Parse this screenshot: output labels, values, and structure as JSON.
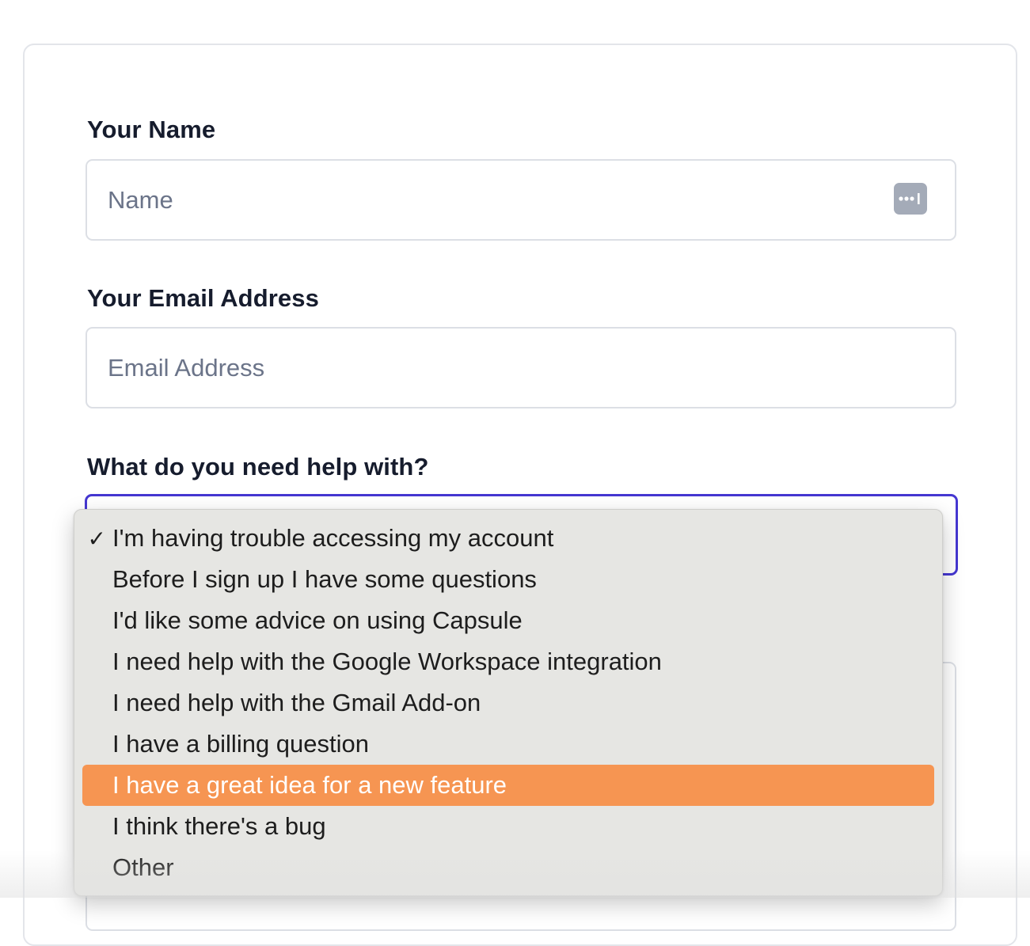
{
  "form": {
    "name_label": "Your Name",
    "name_placeholder": "Name",
    "email_label": "Your Email Address",
    "email_placeholder": "Email Address",
    "help_label": "What do you need help with?"
  },
  "dropdown": {
    "selected_check": "✓",
    "options": [
      {
        "label": "I'm having trouble accessing my account",
        "selected": true,
        "highlighted": false
      },
      {
        "label": "Before I sign up I have some questions",
        "selected": false,
        "highlighted": false
      },
      {
        "label": "I'd like some advice on using Capsule",
        "selected": false,
        "highlighted": false
      },
      {
        "label": "I need help with the Google Workspace integration",
        "selected": false,
        "highlighted": false
      },
      {
        "label": "I need help with the Gmail Add-on",
        "selected": false,
        "highlighted": false
      },
      {
        "label": "I have a billing question",
        "selected": false,
        "highlighted": false
      },
      {
        "label": "I have a great idea for a new feature",
        "selected": false,
        "highlighted": true
      },
      {
        "label": "I think there's a bug",
        "selected": false,
        "highlighted": false
      },
      {
        "label": "Other",
        "selected": false,
        "highlighted": false
      }
    ]
  },
  "colors": {
    "focus_border": "#4537d1",
    "highlight": "#f69552",
    "menu_background": "#e6e6e3"
  }
}
